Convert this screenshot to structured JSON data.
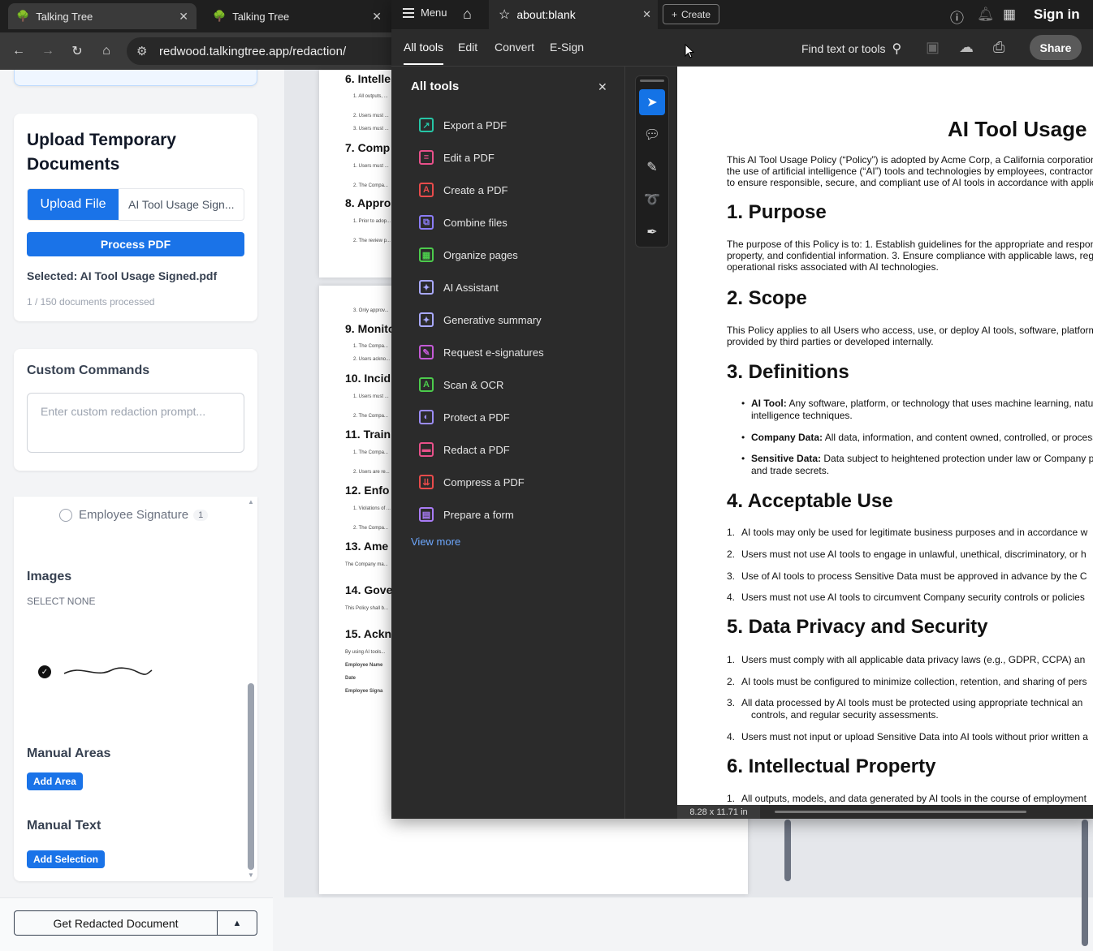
{
  "browser": {
    "tabs": [
      {
        "title": "Talking Tree",
        "close": "✕"
      },
      {
        "title": "Talking Tree",
        "close": "✕"
      }
    ],
    "url": "redwood.talkingtree.app/redaction/"
  },
  "left_panel": {
    "upload_title": "Upload Temporary Documents",
    "upload_button": "Upload File",
    "file_name": "AI Tool Usage Sign...",
    "process_button": "Process PDF",
    "selected": "Selected: AI Tool Usage Signed.pdf",
    "processed": "1 / 150 documents processed",
    "custom_commands_title": "Custom Commands",
    "custom_placeholder": "Enter custom redaction prompt...",
    "employee_signature": {
      "label": "Employee Signature",
      "count": "1"
    },
    "images_title": "Images",
    "select_none": "SELECT NONE",
    "manual_areas_title": "Manual Areas",
    "add_area": "Add Area",
    "manual_text_title": "Manual Text",
    "add_selection": "Add Selection",
    "get_redacted": "Get Redacted Document"
  },
  "preview": {
    "page1_headings": [
      "6. Intelle",
      "7. Comp",
      "8. Appro"
    ],
    "page2_headings": [
      "9. Monito",
      "10. Incid",
      "11. Train",
      "12. Enfo",
      "13. Ame",
      "14. Gove",
      "15. Ackn"
    ],
    "page2_small": [
      "Employee Name",
      "Date",
      "Employee Signa"
    ]
  },
  "acrobat": {
    "menu": "Menu",
    "doc_tab": "about:blank",
    "create": "Create",
    "sign_in": "Sign in",
    "tabs": [
      "All tools",
      "Edit",
      "Convert",
      "E-Sign"
    ],
    "find": "Find text or tools",
    "share": "Share",
    "tools_title": "All tools",
    "tools": [
      {
        "label": "Export a PDF",
        "color": "#26c6a6",
        "glyph": "↗"
      },
      {
        "label": "Edit a PDF",
        "color": "#e8508a",
        "glyph": "≡"
      },
      {
        "label": "Create a PDF",
        "color": "#e84b4b",
        "glyph": "A"
      },
      {
        "label": "Combine files",
        "color": "#8b7cf6",
        "glyph": "⧉"
      },
      {
        "label": "Organize pages",
        "color": "#4ccb4c",
        "glyph": "▦"
      },
      {
        "label": "AI Assistant",
        "color": "#a9a9ff",
        "glyph": "✦"
      },
      {
        "label": "Generative summary",
        "color": "#a9a9ff",
        "glyph": "✦"
      },
      {
        "label": "Request e-signatures",
        "color": "#c45ad6",
        "glyph": "✎"
      },
      {
        "label": "Scan & OCR",
        "color": "#4ccb4c",
        "glyph": "A"
      },
      {
        "label": "Protect a PDF",
        "color": "#9b8cf6",
        "glyph": "◐"
      },
      {
        "label": "Redact a PDF",
        "color": "#e8508a",
        "glyph": "▬"
      },
      {
        "label": "Compress a PDF",
        "color": "#e84b4b",
        "glyph": "⇊"
      },
      {
        "label": "Prepare a form",
        "color": "#a97cf6",
        "glyph": "▤"
      }
    ],
    "view_more": "View more",
    "page_size": "8.28 x 11.71 in"
  },
  "document": {
    "title": "AI Tool Usage P",
    "intro": [
      "This AI Tool Usage Policy (“Policy”) is adopted by Acme Corp, a California corporation",
      "the use of artificial intelligence (“AI”) tools and technologies by employees, contractors",
      "to ensure responsible, secure, and compliant use of AI tools in accordance with applic"
    ],
    "s1_title": "1. Purpose",
    "s1_text": [
      "The purpose of this Policy is to: 1. Establish guidelines for the appropriate and respons",
      "property, and confidential information. 3. Ensure compliance with applicable laws, regu",
      "operational risks associated with AI technologies."
    ],
    "s2_title": "2. Scope",
    "s2_text": [
      "This Policy applies to all Users who access, use, or deploy AI tools, software, platform",
      "provided by third parties or developed internally."
    ],
    "s3_title": "3. Definitions",
    "s3_items": [
      [
        "AI Tool:",
        " Any software, platform, or technology that uses machine learning, natu",
        "intelligence techniques."
      ],
      [
        "Company Data:",
        " All data, information, and content owned, controlled, or process",
        ""
      ],
      [
        "Sensitive Data:",
        " Data subject to heightened protection under law or Company p",
        "and trade secrets."
      ]
    ],
    "s4_title": "4. Acceptable Use",
    "s4_items": [
      "AI tools may only be used for legitimate business purposes and in accordance w",
      "Users must not use AI tools to engage in unlawful, unethical, discriminatory, or h",
      "Use of AI tools to process Sensitive Data must be approved in advance by the C",
      "Users must not use AI tools to circumvent Company security controls or policies"
    ],
    "s5_title": "5. Data Privacy and Security",
    "s5_items": [
      [
        "Users must comply with all applicable data privacy laws (e.g., GDPR, CCPA) an",
        ""
      ],
      [
        "AI tools must be configured to minimize collection, retention, and sharing of pers",
        ""
      ],
      [
        "All data processed by AI tools must be protected using appropriate technical an",
        "controls, and regular security assessments."
      ],
      [
        "Users must not input or upload Sensitive Data into AI tools without prior written a",
        ""
      ]
    ],
    "s6_title": "6. Intellectual Property",
    "s6_items": [
      "All outputs, models, and data generated by AI tools in the course of employment"
    ]
  }
}
